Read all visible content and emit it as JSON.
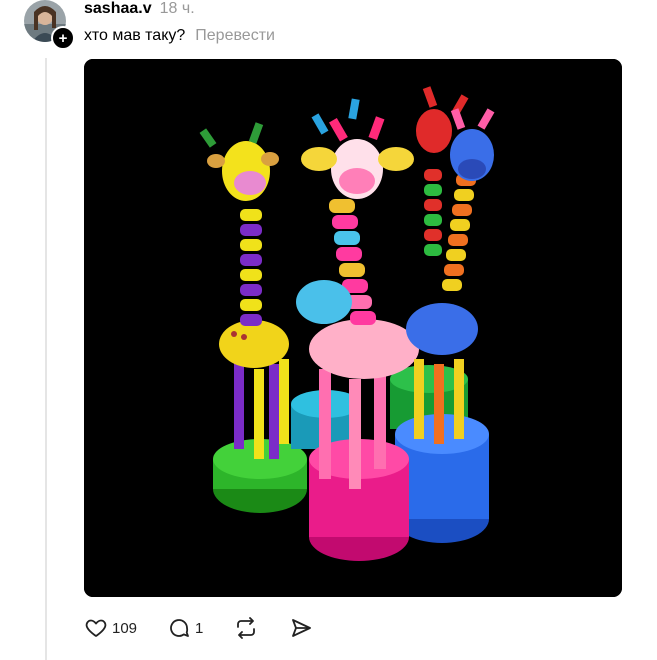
{
  "post": {
    "username": "sashaa.v",
    "time": "18 ч.",
    "text": "хто мав таку?",
    "translate_label": "Перевести"
  },
  "actions": {
    "likes": "109",
    "replies": "1"
  },
  "icons": [
    "heart-icon",
    "reply-icon",
    "repost-icon",
    "share-icon",
    "plus-icon"
  ]
}
